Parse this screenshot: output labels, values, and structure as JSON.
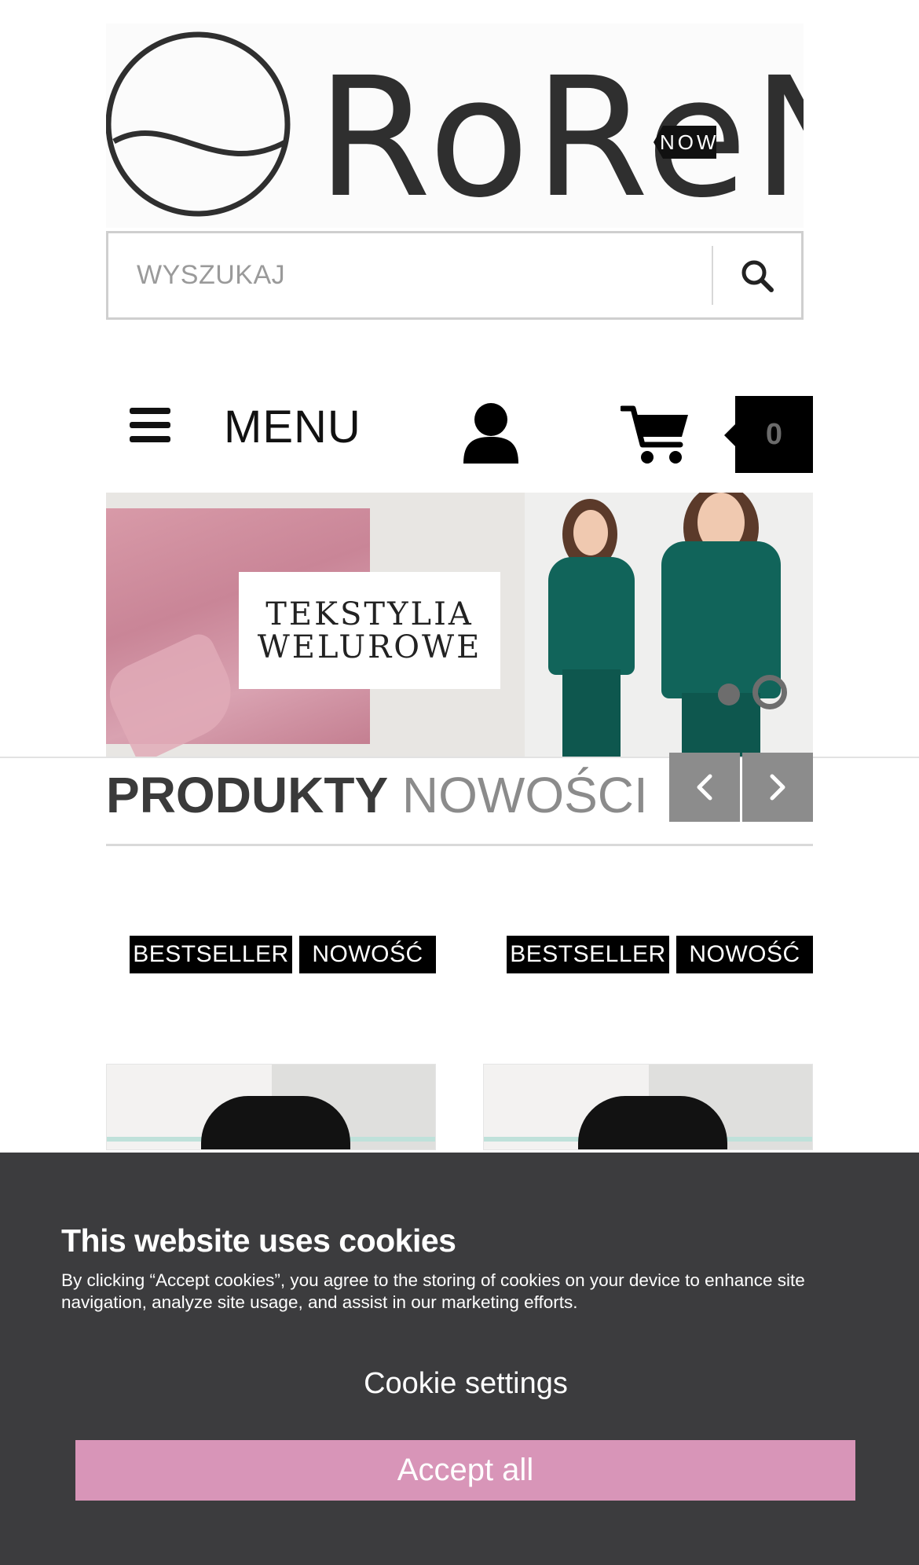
{
  "brand": {
    "logo_text": "RoReNA"
  },
  "search": {
    "placeholder": "WYSZUKAJ",
    "icon": "search-icon"
  },
  "nav": {
    "menu_label": "MENU",
    "menu_icon": "hamburger-icon",
    "account_icon": "user-icon",
    "cart_icon": "cart-icon",
    "cart_count": "0"
  },
  "banner": {
    "card_line_1": "TEKSTYLIA",
    "card_line_2": "WELUROWE",
    "side_tag": "NOW",
    "slides_count": 2,
    "active_slide": 2
  },
  "section": {
    "title_bold": "PRODUKTY",
    "title_light": "NOWOŚCI",
    "prev_icon": "chevron-left-icon",
    "next_icon": "chevron-right-icon"
  },
  "products": [
    {
      "badges": [
        "BESTSELLER",
        "NOWOŚĆ"
      ]
    },
    {
      "badges": [
        "BESTSELLER",
        "NOWOŚĆ"
      ]
    }
  ],
  "cookie": {
    "title": "This website uses cookies",
    "text": "By clicking “Accept cookies”, you agree to the storing of cookies on your device to enhance site navigation, analyze site usage, and assist in our marketing efforts.",
    "settings_label": "Cookie settings",
    "accept_label": "Accept all",
    "accept_color": "#d895b8",
    "background_color": "#3c3c3e"
  }
}
